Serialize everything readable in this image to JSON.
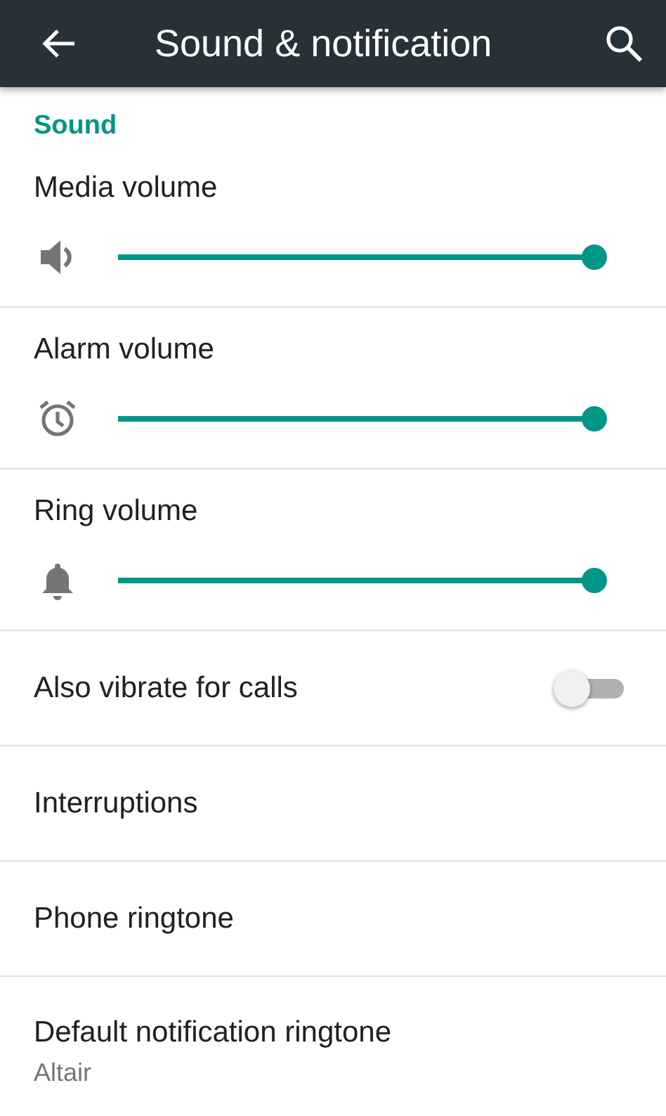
{
  "app_bar": {
    "title": "Sound & notification"
  },
  "section": {
    "title": "Sound"
  },
  "items": [
    {
      "kind": "slider",
      "label": "Media volume",
      "level": 1
    },
    {
      "kind": "slider",
      "label": "Alarm volume",
      "level": 1
    },
    {
      "kind": "slider",
      "label": "Ring volume",
      "level": 1
    },
    {
      "kind": "toggle",
      "label": "Also vibrate for calls",
      "on": false
    },
    {
      "kind": "plain",
      "label": "Interruptions"
    },
    {
      "kind": "plain",
      "label": "Phone ringtone"
    },
    {
      "kind": "summary",
      "label": "Default notification ringtone",
      "summary": "Altair"
    }
  ]
}
